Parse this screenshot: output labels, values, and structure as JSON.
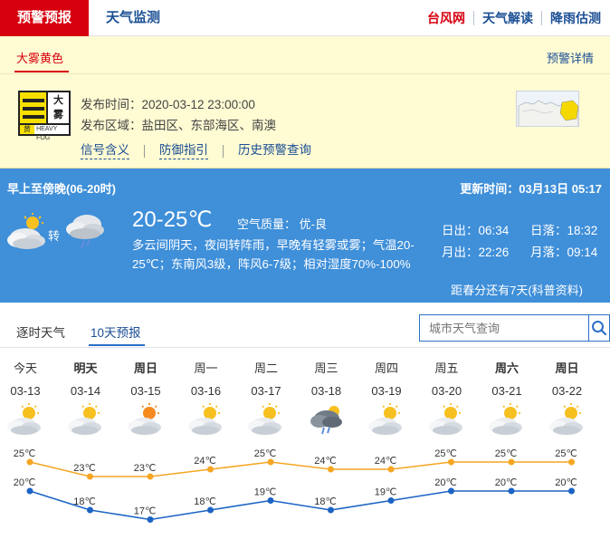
{
  "nav": {
    "active_tab": "预警预报",
    "tab2": "天气监测",
    "right_links": [
      "台风网",
      "天气解读",
      "降雨估测"
    ]
  },
  "alert": {
    "tab_label": "大雾黄色",
    "detail_link": "预警详情",
    "icon_text_top": "大",
    "icon_text_bottom": "雾",
    "icon_level": "黄",
    "icon_en": "HEAVY FOG",
    "time_label": "发布时间：",
    "time_value": "2020-03-12 23:00:00",
    "area_label": "发布区域：",
    "area_value": "盐田区、东部海区、南澳",
    "links": [
      "信号含义",
      "防御指引",
      "历史预警查询"
    ]
  },
  "weather": {
    "period": "早上至傍晚(06-20时)",
    "update": "更新时间：03月13日 05:17",
    "zhuan": "转",
    "temp": "20-25℃",
    "aq": "空气质量：  优-良",
    "desc": "多云间阴天，夜间转阵雨，早晚有轻雾或雾；气温20-25℃；东南风3级，阵风6-7级；相对湿度70%-100%",
    "sunrise": "日出：06:34",
    "sunset": "日落：18:32",
    "moonrise": "月出：22:26",
    "moonset": "月落：09:14",
    "season": "距春分还有7天(科普资料)"
  },
  "forecast": {
    "tab1": "逐时天气",
    "tab2": "10天预报",
    "search_placeholder": "城市天气查询",
    "days": [
      {
        "name": "今天",
        "date": "03-13",
        "bold": false,
        "icon": "partly-cloudy-icon"
      },
      {
        "name": "明天",
        "date": "03-14",
        "bold": true,
        "icon": "partly-cloudy-icon"
      },
      {
        "name": "周日",
        "date": "03-15",
        "bold": true,
        "icon": "sunny-cloudy-icon"
      },
      {
        "name": "周一",
        "date": "03-16",
        "bold": false,
        "icon": "partly-cloudy-icon"
      },
      {
        "name": "周二",
        "date": "03-17",
        "bold": false,
        "icon": "partly-cloudy-icon"
      },
      {
        "name": "周三",
        "date": "03-18",
        "bold": false,
        "icon": "shower-icon"
      },
      {
        "name": "周四",
        "date": "03-19",
        "bold": false,
        "icon": "partly-cloudy-icon"
      },
      {
        "name": "周五",
        "date": "03-20",
        "bold": false,
        "icon": "partly-cloudy-icon"
      },
      {
        "name": "周六",
        "date": "03-21",
        "bold": true,
        "icon": "partly-cloudy-icon"
      },
      {
        "name": "周日",
        "date": "03-22",
        "bold": true,
        "icon": "partly-cloudy-icon"
      }
    ]
  },
  "chart_data": {
    "type": "line",
    "x": [
      "03-13",
      "03-14",
      "03-15",
      "03-16",
      "03-17",
      "03-18",
      "03-19",
      "03-20",
      "03-21",
      "03-22"
    ],
    "series": [
      {
        "values": [
          25,
          23,
          23,
          24,
          25,
          24,
          24,
          25,
          25,
          25
        ],
        "labels": [
          "25℃",
          "23℃",
          "23℃",
          "24℃",
          "25℃",
          "24℃",
          "24℃",
          "25℃",
          "25℃",
          "25℃"
        ],
        "color": "#f5a623"
      },
      {
        "values": [
          20,
          18,
          17,
          18,
          19,
          18,
          19,
          20,
          20,
          20
        ],
        "labels": [
          "20℃",
          "18℃",
          "17℃",
          "18℃",
          "19℃",
          "18℃",
          "19℃",
          "20℃",
          "20℃",
          "20℃"
        ],
        "color": "#1b63c4"
      }
    ]
  },
  "colors": {
    "alert_red": "#d7000f",
    "weather_blue": "#3f8fd9",
    "link_blue": "#1b4f94",
    "high_line": "#f5a623",
    "low_line": "#1b63c4"
  }
}
